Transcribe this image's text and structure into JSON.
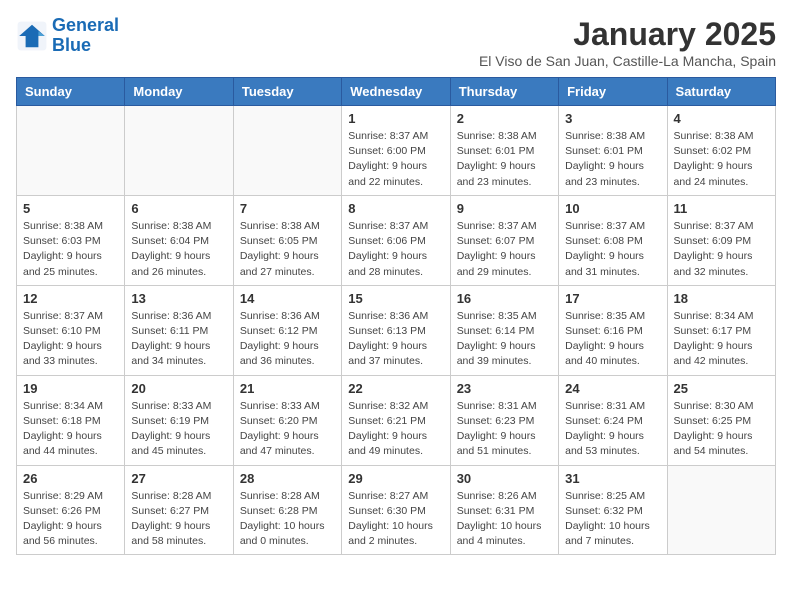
{
  "header": {
    "logo_line1": "General",
    "logo_line2": "Blue",
    "month_title": "January 2025",
    "location": "El Viso de San Juan, Castille-La Mancha, Spain"
  },
  "days_of_week": [
    "Sunday",
    "Monday",
    "Tuesday",
    "Wednesday",
    "Thursday",
    "Friday",
    "Saturday"
  ],
  "weeks": [
    [
      {
        "day": "",
        "info": ""
      },
      {
        "day": "",
        "info": ""
      },
      {
        "day": "",
        "info": ""
      },
      {
        "day": "1",
        "info": "Sunrise: 8:37 AM\nSunset: 6:00 PM\nDaylight: 9 hours\nand 22 minutes."
      },
      {
        "day": "2",
        "info": "Sunrise: 8:38 AM\nSunset: 6:01 PM\nDaylight: 9 hours\nand 23 minutes."
      },
      {
        "day": "3",
        "info": "Sunrise: 8:38 AM\nSunset: 6:01 PM\nDaylight: 9 hours\nand 23 minutes."
      },
      {
        "day": "4",
        "info": "Sunrise: 8:38 AM\nSunset: 6:02 PM\nDaylight: 9 hours\nand 24 minutes."
      }
    ],
    [
      {
        "day": "5",
        "info": "Sunrise: 8:38 AM\nSunset: 6:03 PM\nDaylight: 9 hours\nand 25 minutes."
      },
      {
        "day": "6",
        "info": "Sunrise: 8:38 AM\nSunset: 6:04 PM\nDaylight: 9 hours\nand 26 minutes."
      },
      {
        "day": "7",
        "info": "Sunrise: 8:38 AM\nSunset: 6:05 PM\nDaylight: 9 hours\nand 27 minutes."
      },
      {
        "day": "8",
        "info": "Sunrise: 8:37 AM\nSunset: 6:06 PM\nDaylight: 9 hours\nand 28 minutes."
      },
      {
        "day": "9",
        "info": "Sunrise: 8:37 AM\nSunset: 6:07 PM\nDaylight: 9 hours\nand 29 minutes."
      },
      {
        "day": "10",
        "info": "Sunrise: 8:37 AM\nSunset: 6:08 PM\nDaylight: 9 hours\nand 31 minutes."
      },
      {
        "day": "11",
        "info": "Sunrise: 8:37 AM\nSunset: 6:09 PM\nDaylight: 9 hours\nand 32 minutes."
      }
    ],
    [
      {
        "day": "12",
        "info": "Sunrise: 8:37 AM\nSunset: 6:10 PM\nDaylight: 9 hours\nand 33 minutes."
      },
      {
        "day": "13",
        "info": "Sunrise: 8:36 AM\nSunset: 6:11 PM\nDaylight: 9 hours\nand 34 minutes."
      },
      {
        "day": "14",
        "info": "Sunrise: 8:36 AM\nSunset: 6:12 PM\nDaylight: 9 hours\nand 36 minutes."
      },
      {
        "day": "15",
        "info": "Sunrise: 8:36 AM\nSunset: 6:13 PM\nDaylight: 9 hours\nand 37 minutes."
      },
      {
        "day": "16",
        "info": "Sunrise: 8:35 AM\nSunset: 6:14 PM\nDaylight: 9 hours\nand 39 minutes."
      },
      {
        "day": "17",
        "info": "Sunrise: 8:35 AM\nSunset: 6:16 PM\nDaylight: 9 hours\nand 40 minutes."
      },
      {
        "day": "18",
        "info": "Sunrise: 8:34 AM\nSunset: 6:17 PM\nDaylight: 9 hours\nand 42 minutes."
      }
    ],
    [
      {
        "day": "19",
        "info": "Sunrise: 8:34 AM\nSunset: 6:18 PM\nDaylight: 9 hours\nand 44 minutes."
      },
      {
        "day": "20",
        "info": "Sunrise: 8:33 AM\nSunset: 6:19 PM\nDaylight: 9 hours\nand 45 minutes."
      },
      {
        "day": "21",
        "info": "Sunrise: 8:33 AM\nSunset: 6:20 PM\nDaylight: 9 hours\nand 47 minutes."
      },
      {
        "day": "22",
        "info": "Sunrise: 8:32 AM\nSunset: 6:21 PM\nDaylight: 9 hours\nand 49 minutes."
      },
      {
        "day": "23",
        "info": "Sunrise: 8:31 AM\nSunset: 6:23 PM\nDaylight: 9 hours\nand 51 minutes."
      },
      {
        "day": "24",
        "info": "Sunrise: 8:31 AM\nSunset: 6:24 PM\nDaylight: 9 hours\nand 53 minutes."
      },
      {
        "day": "25",
        "info": "Sunrise: 8:30 AM\nSunset: 6:25 PM\nDaylight: 9 hours\nand 54 minutes."
      }
    ],
    [
      {
        "day": "26",
        "info": "Sunrise: 8:29 AM\nSunset: 6:26 PM\nDaylight: 9 hours\nand 56 minutes."
      },
      {
        "day": "27",
        "info": "Sunrise: 8:28 AM\nSunset: 6:27 PM\nDaylight: 9 hours\nand 58 minutes."
      },
      {
        "day": "28",
        "info": "Sunrise: 8:28 AM\nSunset: 6:28 PM\nDaylight: 10 hours\nand 0 minutes."
      },
      {
        "day": "29",
        "info": "Sunrise: 8:27 AM\nSunset: 6:30 PM\nDaylight: 10 hours\nand 2 minutes."
      },
      {
        "day": "30",
        "info": "Sunrise: 8:26 AM\nSunset: 6:31 PM\nDaylight: 10 hours\nand 4 minutes."
      },
      {
        "day": "31",
        "info": "Sunrise: 8:25 AM\nSunset: 6:32 PM\nDaylight: 10 hours\nand 7 minutes."
      },
      {
        "day": "",
        "info": ""
      }
    ]
  ]
}
